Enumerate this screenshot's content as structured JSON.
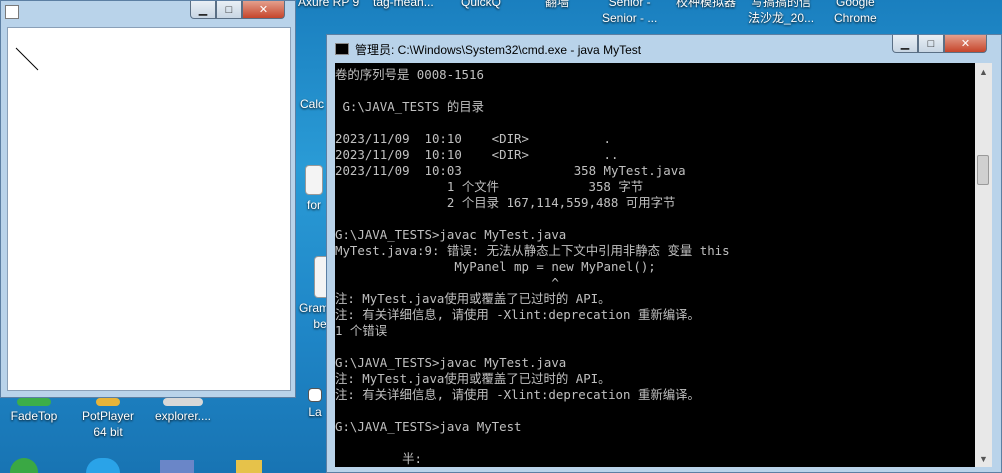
{
  "desktop": {
    "top_labels": [
      {
        "id": "axure",
        "text": "Axure RP 9"
      },
      {
        "id": "tag",
        "text": "tag-mean..."
      },
      {
        "id": "quickq",
        "text": "QuickQ"
      },
      {
        "id": "lane",
        "text": "翻墙"
      },
      {
        "id": "senior",
        "text": "Senior -"
      },
      {
        "id": "sim",
        "text": "校种模拟器"
      },
      {
        "id": "xiaqi",
        "text": "写搞搞的信"
      },
      {
        "id": "chrome",
        "text": "Google"
      }
    ],
    "second_line": [
      {
        "id": "senior2",
        "text": "Senior - ..."
      },
      {
        "id": "fashalong",
        "text": "法沙龙_20..."
      },
      {
        "id": "chrome2",
        "text": "Chrome"
      }
    ],
    "side_labels": [
      {
        "id": "calc",
        "text": "Calc"
      },
      {
        "id": "form",
        "text": "for"
      },
      {
        "id": "gram",
        "text": "Gram"
      },
      {
        "id": "be",
        "text": "be"
      },
      {
        "id": "la",
        "text": "La"
      }
    ],
    "bottom_icons": [
      {
        "id": "fadetop",
        "label": "FadeTop"
      },
      {
        "id": "potplayer",
        "label": "PotPlayer 64 bit"
      },
      {
        "id": "explorer",
        "label": "explorer...."
      }
    ]
  },
  "java_window": {
    "minimize": "▁",
    "maximize": "□",
    "close": "✕"
  },
  "cmd_window": {
    "title": "管理员: C:\\Windows\\System32\\cmd.exe - java  MyTest",
    "minimize": "▁",
    "maximize": "□",
    "close": "✕",
    "lines": [
      "卷的序列号是 0008-1516",
      "",
      " G:\\JAVA_TESTS 的目录",
      "",
      "2023/11/09  10:10    <DIR>          .",
      "2023/11/09  10:10    <DIR>          ..",
      "2023/11/09  10:03               358 MyTest.java",
      "               1 个文件            358 字节",
      "               2 个目录 167,114,559,488 可用字节",
      "",
      "G:\\JAVA_TESTS>javac MyTest.java",
      "MyTest.java:9: 错误: 无法从静态上下文中引用非静态 变量 this",
      "                MyPanel mp = new MyPanel();",
      "                             ^",
      "注: MyTest.java使用或覆盖了已过时的 API。",
      "注: 有关详细信息, 请使用 -Xlint:deprecation 重新编译。",
      "1 个错误",
      "",
      "G:\\JAVA_TESTS>javac MyTest.java",
      "注: MyTest.java使用或覆盖了已过时的 API。",
      "注: 有关详细信息, 请使用 -Xlint:deprecation 重新编译。",
      "",
      "G:\\JAVA_TESTS>java MyTest",
      "",
      "         半:"
    ]
  }
}
